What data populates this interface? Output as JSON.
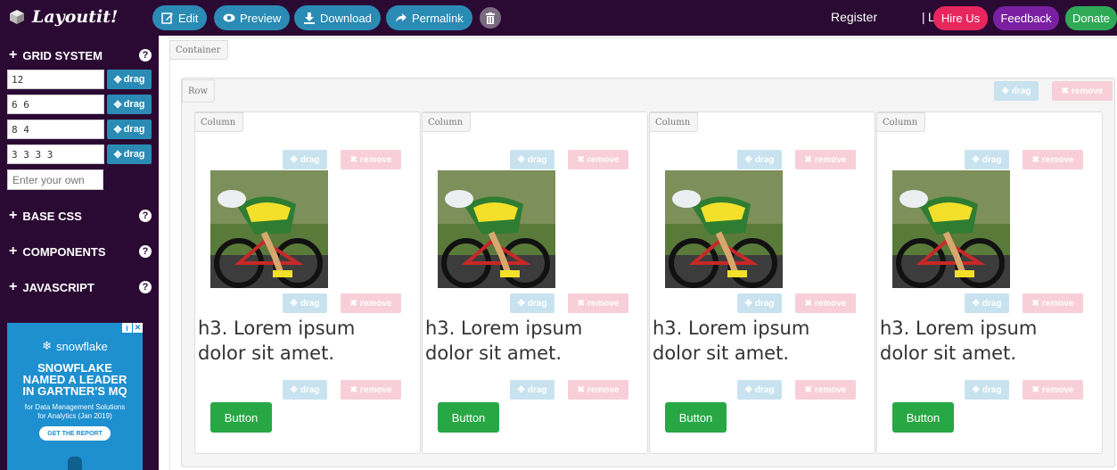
{
  "brand": {
    "name": "Layoutit!"
  },
  "toolbar": {
    "edit": "Edit",
    "preview": "Preview",
    "download": "Download",
    "permalink": "Permalink"
  },
  "account": {
    "register": "Register",
    "separator": "|",
    "login": "Login",
    "hire": "Hire Us",
    "feedback": "Feedback",
    "donate": "Donate"
  },
  "sidebar": {
    "grid_title": "GRID SYSTEM",
    "grid_rows": [
      {
        "value": "12",
        "drag": "drag"
      },
      {
        "value": "6 6",
        "drag": "drag"
      },
      {
        "value": "8 4",
        "drag": "drag"
      },
      {
        "value": "3 3 3 3",
        "drag": "drag"
      }
    ],
    "custom_placeholder": "Enter your own",
    "sections": [
      "BASE CSS",
      "COMPONENTS",
      "JAVASCRIPT"
    ],
    "help_glyph": "?"
  },
  "ad": {
    "brand": "snowflake",
    "headline": [
      "SNOWFLAKE",
      "NAMED A LEADER",
      "IN GARTNER'S MQ"
    ],
    "sub": [
      "for Data Management Solutions",
      "for Analytics (Jan 2019)"
    ],
    "cta": "GET THE REPORT"
  },
  "canvas": {
    "container_label": "Container",
    "row_label": "Row",
    "row_drag": "drag",
    "row_remove": "remove",
    "columns": [
      {
        "label": "Column",
        "heading": "h3. Lorem ipsum dolor sit amet.",
        "button": "Button",
        "drag": "drag",
        "remove": "remove"
      },
      {
        "label": "Column",
        "heading": "h3. Lorem ipsum dolor sit amet.",
        "button": "Button",
        "drag": "drag",
        "remove": "remove"
      },
      {
        "label": "Column",
        "heading": "h3. Lorem ipsum dolor sit amet.",
        "button": "Button",
        "drag": "drag",
        "remove": "remove"
      },
      {
        "label": "Column",
        "heading": "h3. Lorem ipsum dolor sit amet.",
        "button": "Button",
        "drag": "drag",
        "remove": "remove"
      }
    ]
  },
  "colors": {
    "nav_bg": "#2a0a33",
    "nav_button": "#2a8bb5",
    "hire": "#e8265e",
    "feedback": "#7a1fa2",
    "donate": "#2eaa57",
    "button_green": "#28a745"
  },
  "icons": [
    "cube-icon",
    "edit-icon",
    "eye-icon",
    "download-icon",
    "share-icon",
    "trash-icon",
    "plus-icon",
    "question-icon",
    "move-icon",
    "close-icon",
    "snowflake-icon"
  ]
}
